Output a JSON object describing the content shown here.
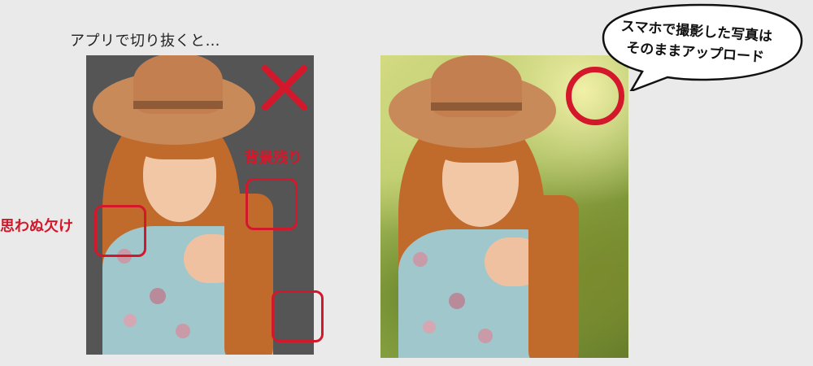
{
  "left": {
    "caption": "アプリで切り抜くと…",
    "labels": {
      "background_remaining": "背景残り",
      "unexpected_missing": "思わぬ欠け"
    }
  },
  "right": {
    "bubble_line1": "スマホで撮影した写真は",
    "bubble_line2": "そのままアップロード"
  },
  "colors": {
    "accent_red": "#d3182b",
    "left_bg": "#555555",
    "page_bg": "#eaeaea"
  }
}
